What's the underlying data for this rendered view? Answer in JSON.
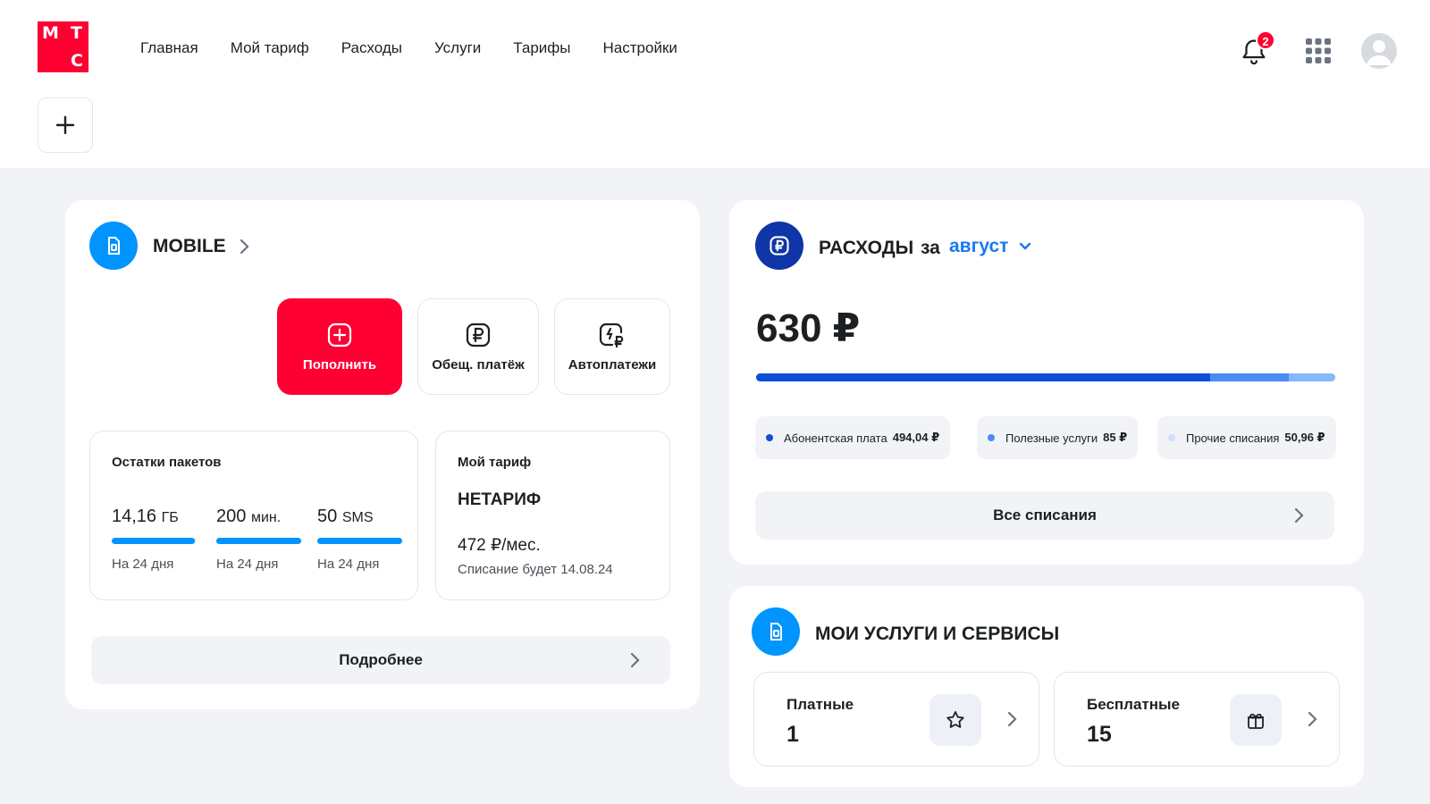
{
  "logo": {
    "letters": [
      "М",
      "Т",
      "С"
    ],
    "color": "#ff0032"
  },
  "nav": [
    "Главная",
    "Мой тариф",
    "Расходы",
    "Услуги",
    "Тарифы",
    "Настройки"
  ],
  "notifications": {
    "count": "2",
    "icon": "bell-icon"
  },
  "mobile": {
    "title": "MOBILE",
    "actions": [
      {
        "label": "Пополнить",
        "icon": "plus-square-icon"
      },
      {
        "label": "Обещ. платёж",
        "icon": "ruble-icon"
      },
      {
        "label": "Автоплатежи",
        "icon": "auto-payment-icon"
      }
    ],
    "packages": {
      "title": "Остатки пакетов",
      "items": [
        {
          "value": "14,16",
          "unit": "ГБ",
          "until": "На 24 дня",
          "remaining_fraction": 0.98
        },
        {
          "value": "200",
          "unit": "мин.",
          "until": "На 24 дня",
          "remaining_fraction": 1.0
        },
        {
          "value": "50",
          "unit": "SMS",
          "until": "На 24 дня",
          "remaining_fraction": 1.0
        }
      ]
    },
    "tariff": {
      "title": "Мой тариф",
      "name": "НЕТАРИФ",
      "price": "472 ₽/мес.",
      "charge_note": "Списание будет 14.08.24"
    },
    "more_button": "Подробнее"
  },
  "spending": {
    "title": "РАСХОДЫ",
    "period_prefix": "за",
    "period": "август",
    "total": "630 ₽",
    "segments": [
      {
        "label": "Абонентская плата",
        "amount": "494,04 ₽",
        "value": 494.04,
        "color": "#0f4fd8"
      },
      {
        "label": "Полезные услуги",
        "amount": "85 ₽",
        "value": 85,
        "color": "#4a8cf2"
      },
      {
        "label": "Прочие списания",
        "amount": "50,96 ₽",
        "value": 50.96,
        "color": "#86b6fb"
      }
    ],
    "all_button": "Все списания"
  },
  "services": {
    "title": "МОИ УСЛУГИ И СЕРВИСЫ",
    "items": [
      {
        "label": "Платные",
        "count": "1",
        "icon": "star-icon"
      },
      {
        "label": "Бесплатные",
        "count": "15",
        "icon": "gift-icon"
      }
    ]
  }
}
